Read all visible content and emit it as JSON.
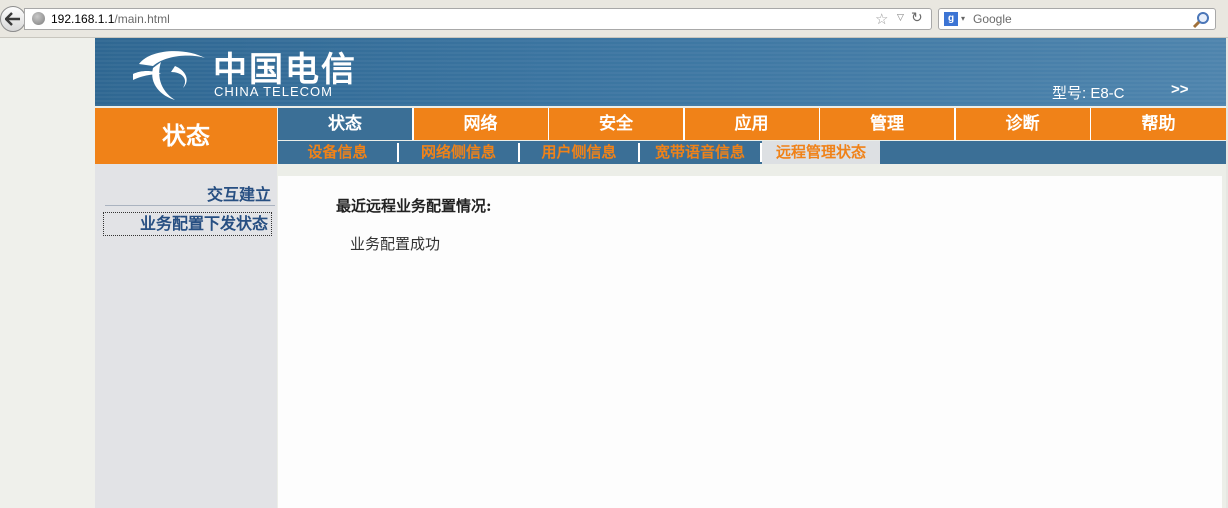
{
  "browser": {
    "url_host": "192.168.1.1",
    "url_path": "/main.html",
    "search_placeholder": "Google",
    "search_engine_icon": "g"
  },
  "banner": {
    "logo_cn": "中国电信",
    "logo_en": "CHINA TELECOM",
    "model": "型号: E8-C",
    "more": ">>"
  },
  "section_title": "状态",
  "main_tabs": [
    "状态",
    "网络",
    "安全",
    "应用",
    "管理",
    "诊断",
    "帮助"
  ],
  "sub_tabs": [
    "设备信息",
    "网络侧信息",
    "用户侧信息",
    "宽带语音信息",
    "远程管理状态"
  ],
  "sidebar": {
    "items": [
      "交互建立",
      "业务配置下发状态"
    ]
  },
  "content": {
    "title": "最近远程业务配置情况:",
    "message": "业务配置成功"
  },
  "colors": {
    "orange": "#f08218",
    "blue": "#3b6f96"
  }
}
